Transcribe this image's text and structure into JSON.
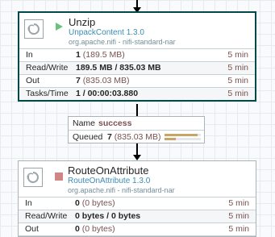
{
  "processors": [
    {
      "name": "Unzip",
      "type": "UnpackContent 1.3.0",
      "bundle": "org.apache.nifi - nifi-standard-nar",
      "status": "running",
      "stats": {
        "in": {
          "label": "In",
          "count": "1",
          "detail": "(189.5 MB)",
          "time": "5 min"
        },
        "rw": {
          "label": "Read/Write",
          "value": "189.5 MB / 835.03 MB",
          "time": "5 min"
        },
        "out": {
          "label": "Out",
          "count": "7",
          "detail": "(835.03 MB)",
          "time": "5 min"
        },
        "tasks": {
          "label": "Tasks/Time",
          "value": "1 / 00:00:03.880",
          "time": "5 min"
        }
      }
    },
    {
      "name": "RouteOnAttribute",
      "type": "RouteOnAttribute 1.3.0",
      "bundle": "org.apache.nifi - nifi-standard-nar",
      "status": "stopped",
      "stats": {
        "in": {
          "label": "In",
          "count": "0",
          "detail": "(0 bytes)",
          "time": "5 min"
        },
        "rw": {
          "label": "Read/Write",
          "value": "0 bytes / 0 bytes",
          "time": "5 min"
        },
        "out": {
          "label": "Out",
          "count": "0",
          "detail": "(0 bytes)",
          "time": "5 min"
        }
      }
    }
  ],
  "connection": {
    "name_label": "Name",
    "name_value": "success",
    "queued_label": "Queued",
    "queued_count": "7",
    "queued_detail": "(835.03 MB)",
    "backpressure_object_fraction": 0.9,
    "backpressure_size_fraction": 0.3
  },
  "colors": {
    "running": "#6ac27e",
    "stopped": "#d18686",
    "selected_border": "#004849",
    "type_text": "#3b8cb5"
  }
}
